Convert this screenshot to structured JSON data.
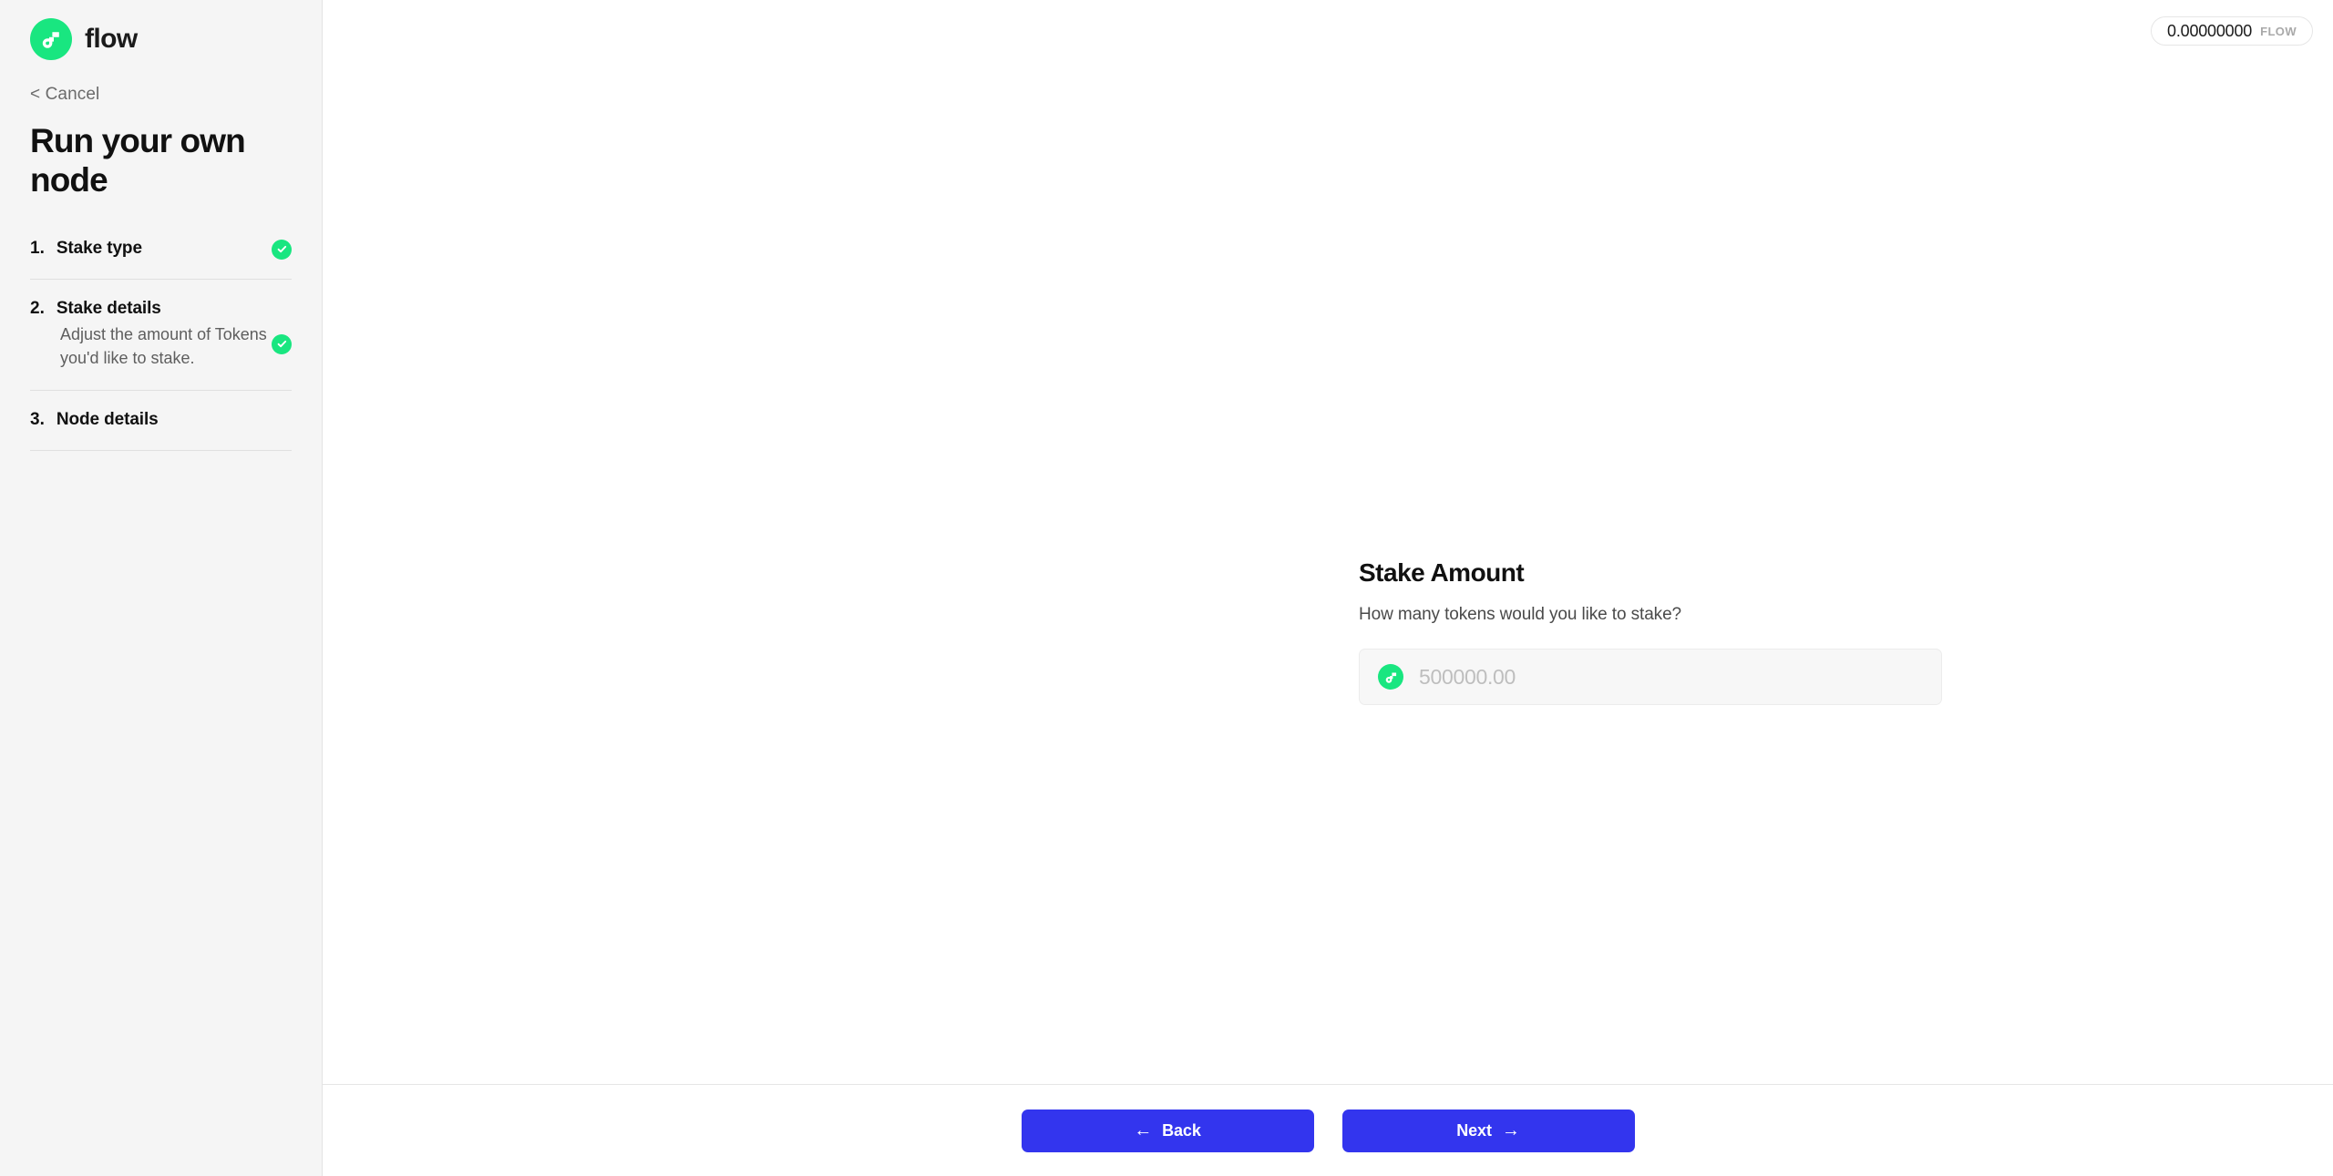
{
  "brand": {
    "name": "flow",
    "logo_icon": "flow-logo-icon",
    "accent_green": "#19e680"
  },
  "sidebar": {
    "cancel_label": "< Cancel",
    "title": "Run your own node",
    "steps": [
      {
        "number": "1.",
        "label": "Stake type",
        "description": "",
        "completed": true
      },
      {
        "number": "2.",
        "label": "Stake details",
        "description": "Adjust the amount of Tokens you'd like to stake.",
        "completed": true
      },
      {
        "number": "3.",
        "label": "Node details",
        "description": "",
        "completed": false
      }
    ]
  },
  "topbar": {
    "balance_amount": "0.00000000",
    "balance_unit": "FLOW"
  },
  "main": {
    "heading": "Stake Amount",
    "subheading": "How many tokens would you like to stake?",
    "amount_value": "",
    "amount_placeholder": "500000.00",
    "field_icon": "flow-token-icon"
  },
  "footer": {
    "back_label": "Back",
    "back_arrow": "←",
    "next_label": "Next",
    "next_arrow": "→",
    "button_color": "#3335ee"
  }
}
